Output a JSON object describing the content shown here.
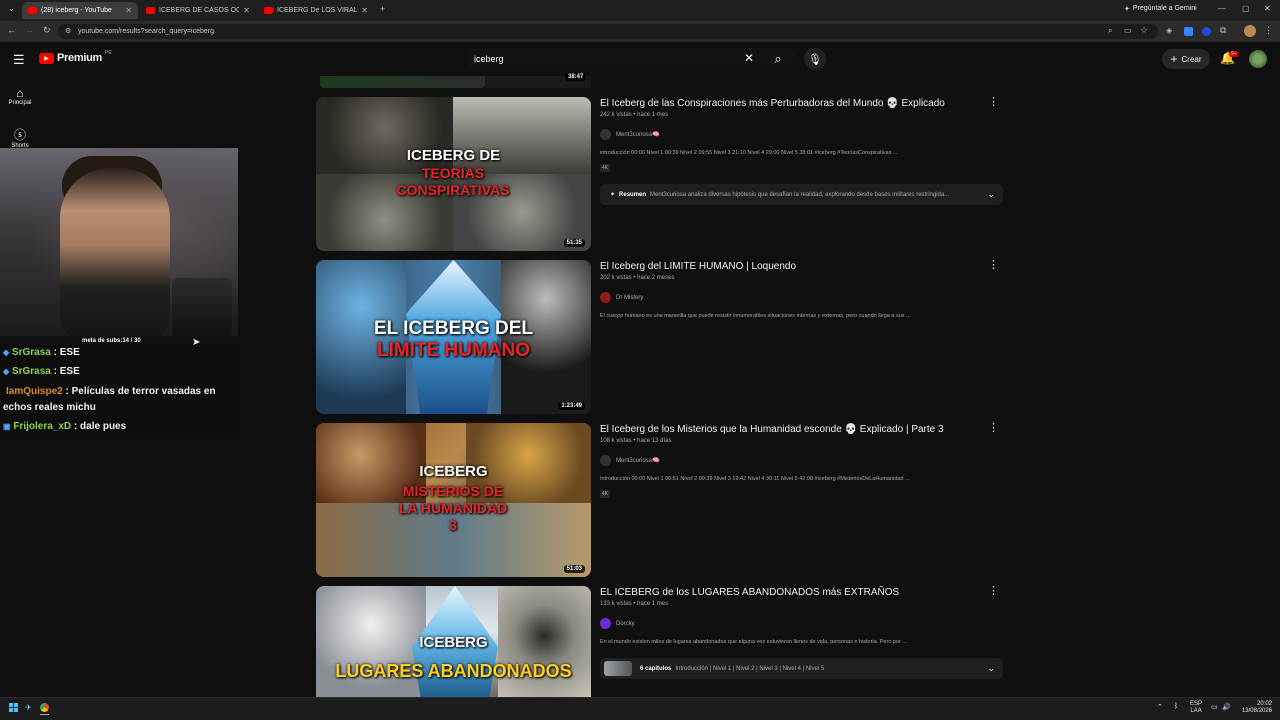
{
  "browser": {
    "tabs": [
      {
        "label": "(28) iceberg - YouTube",
        "active": true
      },
      {
        "label": "ICEBERG DE CASOS OCURRIDO",
        "active": false
      },
      {
        "label": "ICEBERG De LOS VIRALES (Caso",
        "active": false
      }
    ],
    "new_tab": "+",
    "gemini_label": "Pregúntale a Gemini",
    "url": "youtube.com/results?search_query=iceberg"
  },
  "youtube": {
    "logo": "Premium",
    "logo_region": "PE",
    "search_value": "iceberg",
    "create_label": "Crear",
    "notif_count": "9+",
    "sidebar": [
      {
        "label": "Principal",
        "icon": "home-icon"
      },
      {
        "label": "Shorts",
        "icon": "shorts-icon"
      }
    ]
  },
  "stream_overlay": {
    "webcam_caption": "meta de subs:14 / 30",
    "chat": [
      {
        "user": "SrGrasa",
        "message": "ESE",
        "color": "#8fd14f"
      },
      {
        "user": "SrGrasa",
        "message": "ESE",
        "color": "#8fd14f"
      },
      {
        "user": "IamQuispe2",
        "message": "Películas de terror vasadas en echos reales michu",
        "color": "#d98b2b"
      },
      {
        "user": "Frijolera_xD",
        "message": "dale pues",
        "color": "#8fd14f"
      }
    ]
  },
  "results": [
    {
      "partial_duration": "38:47"
    },
    {
      "title": "El Iceberg de las Conspiraciones más Perturbadoras del Mundo 💀 Explicado",
      "meta": "242 k vistas • hace 1 mes",
      "channel": "Ment3curiosa🧠",
      "desc": "introducción 00:00 Nivel 1 00:39 Nivel 2 09:55 Nivel 3 21:10 Nivel 4 29:00 Nivel 5 38:01 #iceberg #TeoriasConspirativas ...",
      "badge": "4K",
      "summary_label": "Resumen",
      "summary_text": "Ment3curiosa analiza diversas hipótesis que desafían la realidad, explorando desde bases militares restringida...",
      "duration": "51:35",
      "thumb_line1": "ICEBERG DE",
      "thumb_line2": "TEORÍAS CONSPIRATIVAS"
    },
    {
      "title": "El Iceberg del LIMITE HUMANO | Loquendo",
      "meta": "202 k vistas • hace 2 meses",
      "channel": "Dr Mistery",
      "desc": "El cuerpo humano es una maravilla que puede resistir innumerables situaciones internas y externas, pero cuando llega a sus ...",
      "duration": "1:23:49",
      "thumb_line1": "EL ICEBERG DEL",
      "thumb_line2": "LIMITE HUMANO"
    },
    {
      "title": "El Iceberg de los Misterios que la Humanidad esconde 💀 Explicado | Parte 3",
      "meta": "108 k vistas • hace 13 días",
      "channel": "Ment3curiosa🧠",
      "desc": "Introducción 00:00 Nivel 1 00:51 Nivel 2 09:39 Nivel 3 19:42 Nivel 4 30:11 Nivel 5 42:08 #iceberg #MisteriosDeLaHumanidad ...",
      "badge": "4K",
      "duration": "51:03",
      "thumb_line1": "ICEBERG",
      "thumb_line2": "MISTERIOS DE LA HUMANIDAD 3"
    },
    {
      "title": "EL ICEBERG de los LUGARES ABANDONADOS más EXTRAÑOS",
      "meta": "133 k vistas • hace 1 mes",
      "channel": "Dorcky",
      "desc": "En el mundo existen miles de lugares abandonados que alguna vez estuvieron llenos de vida, personas e historia. Pero por ...",
      "chapters_label": "6 capítulos",
      "chapters_text": "Introducción | Nivel 1 | Nivel 2 | Nivel 3 | Nivel 4 | Nivel 5",
      "thumb_line1": "ICEBERG",
      "thumb_line2": "LUGARES ABANDONADOS"
    }
  ],
  "taskbar": {
    "lang": "ESP",
    "lang2": "LAA",
    "time": "20:02",
    "date": "13/08/2026"
  }
}
